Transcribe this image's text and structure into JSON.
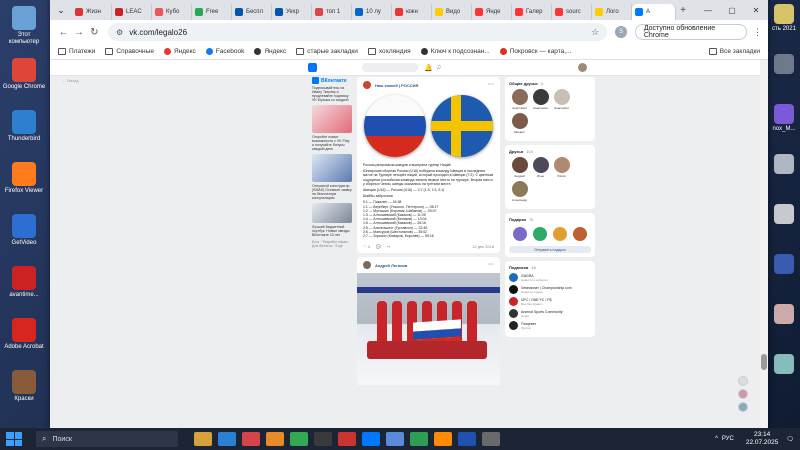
{
  "desktop": {
    "left_icons": [
      {
        "label": "Этот компьютер",
        "color": "#6aa2d8"
      },
      {
        "label": "Google Chrome",
        "color": "#e0453a"
      },
      {
        "label": "Thunderbird",
        "color": "#2f7fd1"
      },
      {
        "label": "Firefox Viewer",
        "color": "#ff7b1c"
      },
      {
        "label": "GetVideo",
        "color": "#2c6fd0"
      },
      {
        "label": "avantime...",
        "color": "#cc2222"
      },
      {
        "label": "Adobe Acrobat",
        "color": "#d6261f"
      },
      {
        "label": "Краски",
        "color": "#8a5b3b"
      }
    ],
    "right_icons": [
      {
        "label": "сть 2021",
        "color": "#d8c36a"
      },
      {
        "label": "",
        "color": "#6e7a8a"
      },
      {
        "label": "nox_M...",
        "color": "#7a5ad8"
      },
      {
        "label": "",
        "color": "#b0b7c2"
      },
      {
        "label": "",
        "color": "#c7c9cf"
      },
      {
        "label": "",
        "color": "#3a5bb0"
      },
      {
        "label": "",
        "color": "#caa"
      },
      {
        "label": "",
        "color": "#8bb"
      }
    ]
  },
  "browser": {
    "tabs": [
      {
        "label": "Жизн",
        "color": "#d33"
      },
      {
        "label": "LEAC",
        "color": "#c22"
      },
      {
        "label": "Кубо",
        "color": "#e55"
      },
      {
        "label": "Free",
        "color": "#2a5"
      },
      {
        "label": "Беспл",
        "color": "#05a"
      },
      {
        "label": "Уехр",
        "color": "#05a"
      },
      {
        "label": "топ 1",
        "color": "#d44"
      },
      {
        "label": "10 лу",
        "color": "#06c"
      },
      {
        "label": "южн",
        "color": "#e33"
      },
      {
        "label": "Видо",
        "color": "#fc0"
      },
      {
        "label": "Янде",
        "color": "#f33"
      },
      {
        "label": "Галер",
        "color": "#f33"
      },
      {
        "label": "sourc",
        "color": "#f33"
      },
      {
        "label": "Лого",
        "color": "#fc0"
      },
      {
        "label": "А",
        "color": "#0077ff",
        "active": true
      }
    ],
    "url": "vk.com/legalo26",
    "profile_letter": "S",
    "update_button": "Доступно обновление Chrome",
    "bookmarks": [
      {
        "label": "Платежи",
        "kind": "folder"
      },
      {
        "label": "Справочные",
        "kind": "folder"
      },
      {
        "label": "Яндекс",
        "kind": "star"
      },
      {
        "label": "Facebook",
        "kind": "fb"
      },
      {
        "label": "Яндекс",
        "kind": "dot"
      },
      {
        "label": "старые закладки",
        "kind": "folder"
      },
      {
        "label": "хохляндия",
        "kind": "folder"
      },
      {
        "label": "Ключ к подсознан...",
        "kind": "dot"
      },
      {
        "label": "Покровск — карта,...",
        "kind": "pin"
      }
    ],
    "all_bookmarks": "Все закладки"
  },
  "vk": {
    "back_link": "← Назад",
    "left_ads": [
      {
        "title": "ВКонтакте",
        "text": "Подписывайтесь на Ивану Ткачеву и продлевайте подписку VK Музыка со скидкой"
      },
      {
        "text": "Откройте новые возможности с VK Play и получайте бонусы каждый день"
      },
      {
        "text": "Отпускной конструктор (SMAS) Оставьте заявку на бесплатную консультацию"
      },
      {
        "text": "Лучший бюджетный ноутбук. Новые звезды ВКонтакте 10 лет"
      }
    ],
    "left_footer": "Блог · Разработчикам · Для бизнеса · Ещё",
    "post1": {
      "author": "Наш хоккей | РОССИЯ",
      "title": "Россия разгромила шведов и выиграла турнир Наций",
      "body": "Юниорская сборная России (U16) победила команду Швеции в последнем матче на Турнире четырёх наций, который проходил в Швеции (7:2). С цветным ощущения российская команда заняла первое место на турнире. Вторая место у сборных Чехии, шведы оказались на третьем месте.",
      "score_line": "Швеция (U16) — Россия (U16) — 2:7 (1:3, 1:3, 0:1)",
      "scorers_title": "Шайбы забросили",
      "scorers": [
        "0:1 — Пикалин — 04:38",
        "1:1 — Вернберг (Ульссон, Петтерсон) — 08:17",
        "1:2 — Мутышин (Боровик, Шабанов) — 09:07",
        "1:3 — Алтышевский (Казаков) — 11:05",
        "1:4 — Алтышевский (Беляков) — 13:04",
        "1:5 — Алтышевский (Казаков) — 26:16",
        "2:5 — Альтельсеот (Густавсон) — 32:45",
        "2:6 — Мансуров (Шестопалов) — 35:02",
        "2:7 — Зорькин (Комаров, Королёв) — 59:16"
      ],
      "likes": "4",
      "date": "12 дек 2018"
    },
    "post2": {
      "author": "Андрей Легалов"
    },
    "friends_card": {
      "title": "Общие друзья",
      "count": "4",
      "friends": [
        {
          "name": "Анастасия",
          "color": "#8b6a5a"
        },
        {
          "name": "Анастасия",
          "color": "#3b3b3b"
        },
        {
          "name": "Анастасия",
          "color": "#c9c0b5"
        },
        {
          "name": "Михаил",
          "color": "#7d5a4a"
        }
      ]
    },
    "friends2_card": {
      "title": "Друзья",
      "count": "104",
      "friends": [
        {
          "name": "Андрей",
          "color": "#6a4a3a"
        },
        {
          "name": "Илья",
          "color": "#4a4a5a"
        },
        {
          "name": "Юлия",
          "color": "#b08a70"
        },
        {
          "name": "Александр",
          "color": "#8a7a5a"
        }
      ]
    },
    "gifts_card": {
      "title": "Подарки",
      "count": "75",
      "gifts": [
        "#7b68c8",
        "#2fa86a",
        "#e0a030",
        "#c06030"
      ],
      "button": "Отправить подарок"
    },
    "subs_card": {
      "title": "Подписки",
      "count": "46",
      "items": [
        {
          "name": "GAGRA",
          "sub": "Новости и события",
          "color": "#1a6ac0"
        },
        {
          "name": "Чемпионат | Championship.com",
          "sub": "Новости спорта",
          "color": "#111"
        },
        {
          "name": "UFC / ONE FC / РБ",
          "sub": "Бои без правил",
          "color": "#c22"
        },
        {
          "name": "Arsenal Sports Community",
          "sub": "Спорт",
          "color": "#333"
        },
        {
          "name": "Птицевет",
          "sub": "Группа",
          "color": "#222"
        }
      ]
    }
  },
  "taskbar": {
    "search_placeholder": "Поиск",
    "apps": [
      "#d6a03a",
      "#2b7fd4",
      "#d5434b",
      "#e8892a",
      "#34a853",
      "#3a3a3a",
      "#cc3333",
      "#0077ff",
      "#5a8ad8",
      "#2f9e55",
      "#ff8c00",
      "#2050b0",
      "#6a6a6a"
    ],
    "lang": "РУС",
    "time": "23:14",
    "date": "22.07.2025"
  }
}
